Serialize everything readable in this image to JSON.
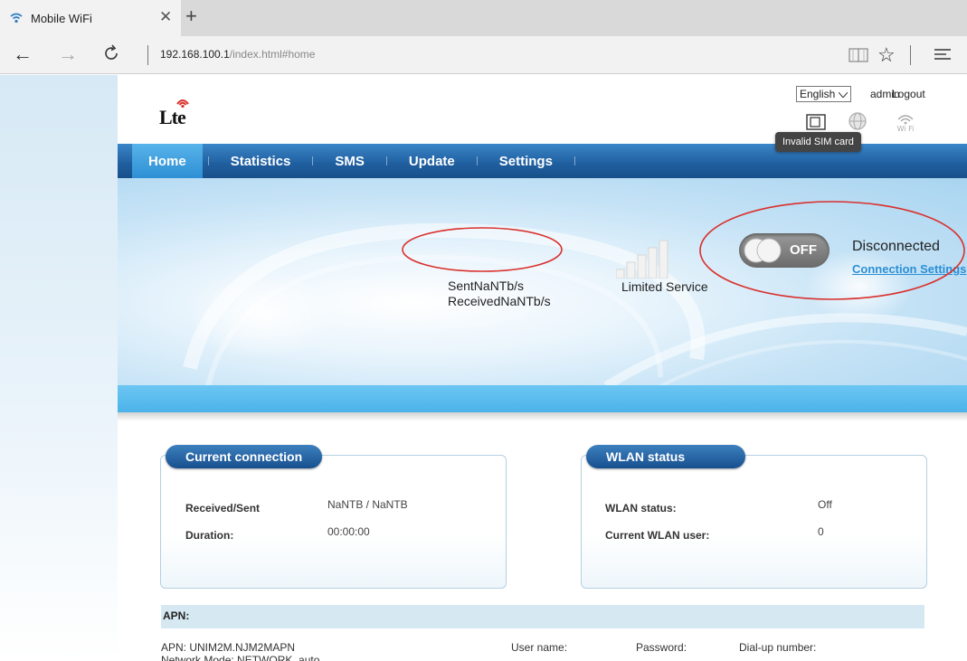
{
  "browser": {
    "tab_title": "Mobile WiFi",
    "url_host": "192.168.100.1",
    "url_path": "/index.html#home"
  },
  "header": {
    "logo_text": "Lte",
    "language": "English",
    "user": "admin",
    "logout": "Logout",
    "tooltip": "Invalid SIM card"
  },
  "nav": {
    "items": [
      {
        "label": "Home",
        "active": true
      },
      {
        "label": "Statistics"
      },
      {
        "label": "SMS"
      },
      {
        "label": "Update"
      },
      {
        "label": "Settings"
      }
    ]
  },
  "banner": {
    "sent": "SentNaNTb/s",
    "received": "ReceivedNaNTb/s",
    "service": "Limited Service",
    "toggle_label": "OFF",
    "connection_status": "Disconnected",
    "connection_link": "Connection Settings"
  },
  "current_connection": {
    "title": "Current connection",
    "received_sent_label": "Received/Sent",
    "received_sent_value": "NaNTB /  NaNTB",
    "duration_label": "Duration:",
    "duration_value": "00:00:00"
  },
  "wlan": {
    "title": "WLAN status",
    "status_label": "WLAN status:",
    "status_value": "Off",
    "users_label": "Current WLAN user:",
    "users_value": "0"
  },
  "apn": {
    "title": "APN:",
    "apn_value": "APN: UNIM2M.NJM2MAPN",
    "network_mode": "Network Mode: NETWORK_auto",
    "user_name": "User name:",
    "password": "Password:",
    "dialup": "Dial-up number:"
  },
  "colors": {
    "nav_blue": "#1f5e9e",
    "nav_active": "#2d8fd4",
    "link_blue": "#2a8fd6",
    "annotation_red": "#d9302c"
  }
}
